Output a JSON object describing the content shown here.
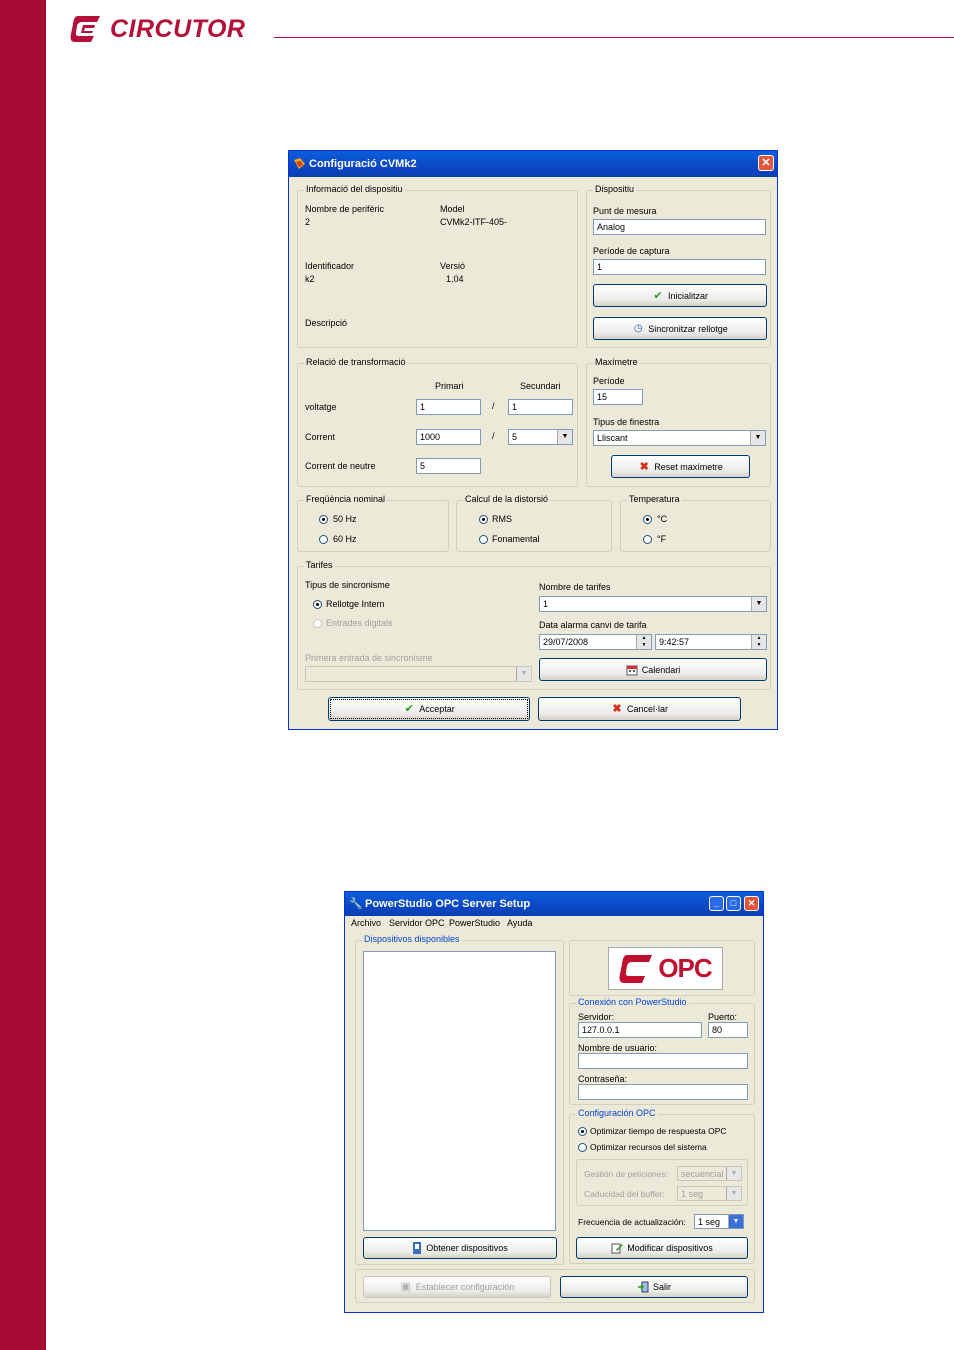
{
  "brand": {
    "name": "CIRCUTOR",
    "color": "#b4113a",
    "sidebar_color": "#a50b32"
  },
  "win1": {
    "title": "Configuració CVMk2",
    "close_glyph": "✕",
    "info": {
      "legend": "Informació del dispositiu",
      "peripheral_label": "Nombre de perifèric",
      "peripheral_value": "2",
      "model_label": "Model",
      "model_value": "CVMk2-ITF-405-",
      "id_label": "Identificador",
      "id_value": "k2",
      "version_label": "Versió",
      "version_value": "1.04",
      "description_label": "Descripció"
    },
    "device": {
      "legend": "Dispositiu",
      "point_label": "Punt de mesura",
      "point_value": "Analog",
      "period_label": "Període de captura",
      "period_value": "1",
      "init_button": "Inicialitzar",
      "sync_button": "Sincronitzar rellotge"
    },
    "transform": {
      "legend": "Relació de transformació",
      "primary_header": "Primari",
      "secondary_header": "Secundari",
      "voltage_label": "voltatge",
      "voltage_primary": "1",
      "voltage_secondary": "1",
      "current_label": "Corrent",
      "current_primary": "1000",
      "current_secondary": "5",
      "neutral_label": "Corrent de neutre",
      "neutral_value": "5",
      "slash": "/"
    },
    "maximeter": {
      "legend": "Maxímetre",
      "period_label": "Període",
      "period_value": "15",
      "window_label": "Tipus de finestra",
      "window_value": "Lliscant",
      "reset_button": "Reset maxímetre"
    },
    "frequency": {
      "legend": "Freqüència nominal",
      "opt1": "50 Hz",
      "opt2": "60 Hz"
    },
    "distortion": {
      "legend": "Calcul de la distorsió",
      "opt1": "RMS",
      "opt2": "Fonamental"
    },
    "temperature": {
      "legend": "Temperatura",
      "opt1": "°C",
      "opt2": "°F"
    },
    "tariffs": {
      "legend": "Tarifes",
      "sync_type_label": "Tipus de sincronisme",
      "opt_internal": "Rellotge Intern",
      "opt_digital": "Entrades digitals",
      "first_input_label": "Primera entrada de sincronisme",
      "num_tariffs_label": "Nombre de tarifes",
      "num_tariffs_value": "1",
      "alarm_date_label": "Data alarma canvi de tarifa",
      "date_value": "29/07/2008",
      "time_value": "9:42:57",
      "calendar_button": "Calendari"
    },
    "accept_button": "Acceptar",
    "cancel_button": "Cancel·lar"
  },
  "win2": {
    "title": "PowerStudio OPC Server Setup",
    "menu": [
      "Archivo",
      "Servidor OPC",
      "PowerStudio",
      "Ayuda"
    ],
    "devices_legend": "Dispositivos disponibles",
    "logo_text": "OPC",
    "connection": {
      "legend": "Conexión con PowerStudio",
      "server_label": "Servidor:",
      "server_value": "127.0.0.1",
      "port_label": "Puerto:",
      "port_value": "80",
      "user_label": "Nombre de usuario:",
      "password_label": "Contraseña:"
    },
    "opc_config": {
      "legend": "Configuración OPC",
      "opt1": "Optimizar tiempo de respuesta OPC",
      "opt2": "Optimizar recursos del sistema",
      "requests_label": "Gestión de peticiones:",
      "requests_value": "secuencial",
      "buffer_label": "Caducidad del buffer:",
      "buffer_value": "1 seg",
      "update_label": "Frecuencia de actualización:",
      "update_value": "1 seg"
    },
    "get_devices_button": "Obtener dispositivos",
    "modify_devices_button": "Modificar dispositivos",
    "set_config_button": "Establecer configuración",
    "exit_button": "Salir"
  }
}
